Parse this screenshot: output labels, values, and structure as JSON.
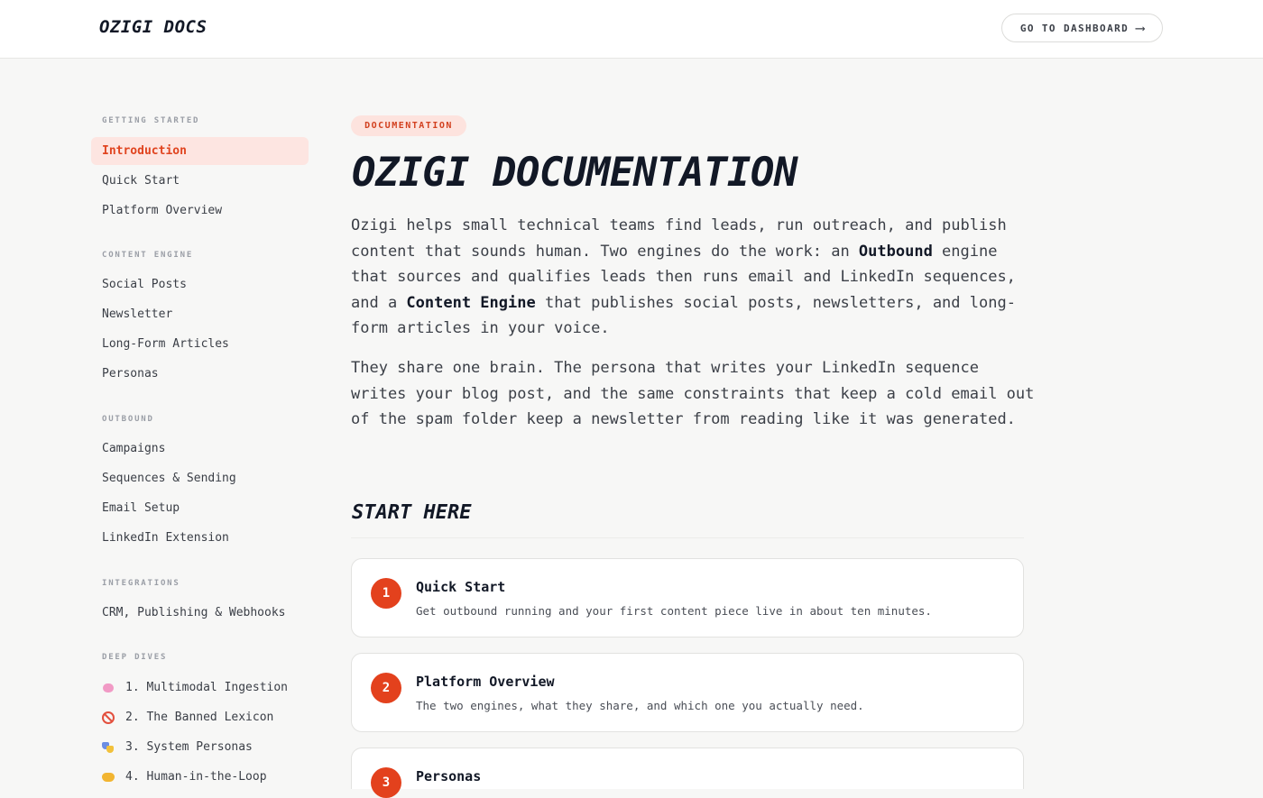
{
  "header": {
    "logo": "OZIGI DOCS",
    "dashboard_button": "GO TO DASHBOARD",
    "dashboard_arrow": "⟶"
  },
  "sidebar": {
    "sections": [
      {
        "title": "GETTING STARTED",
        "items": [
          "Introduction",
          "Quick Start",
          "Platform Overview"
        ]
      },
      {
        "title": "CONTENT ENGINE",
        "items": [
          "Social Posts",
          "Newsletter",
          "Long-Form Articles",
          "Personas"
        ]
      },
      {
        "title": "OUTBOUND",
        "items": [
          "Campaigns",
          "Sequences & Sending",
          "Email Setup",
          "LinkedIn Extension"
        ]
      },
      {
        "title": "INTEGRATIONS",
        "items": [
          "CRM, Publishing & Webhooks"
        ]
      },
      {
        "title": "DEEP DIVES",
        "items": [
          "1. Multimodal Ingestion",
          "2. The Banned Lexicon",
          "3. System Personas",
          "4. Human-in-the-Loop"
        ]
      }
    ],
    "active_item": "Introduction",
    "deep_dive_icons": [
      "brain-icon",
      "no-entry-icon",
      "performing-arts-icon",
      "handshake-icon"
    ]
  },
  "main": {
    "badge": "DOCUMENTATION",
    "title": "OZIGI DOCUMENTATION",
    "intro": {
      "p1_a": "Ozigi helps small technical teams find leads, run outreach, and publish content that sounds human. Two engines do the work: an ",
      "p1_b": "Outbound",
      "p1_c": " engine that sources and qualifies leads then runs email and LinkedIn sequences, and a ",
      "p1_d": "Content Engine",
      "p1_e": " that publishes social posts, newsletters, and long-form articles in your voice.",
      "p2": "They share one brain. The persona that writes your LinkedIn sequence writes your blog post, and the same constraints that keep a cold email out of the spam folder keep a newsletter from reading like it was generated."
    },
    "start_here_title": "START HERE",
    "cards": [
      {
        "number": "1",
        "title": "Quick Start",
        "description": "Get outbound running and your first content piece live in about ten minutes."
      },
      {
        "number": "2",
        "title": "Platform Overview",
        "description": "The two engines, what they share, and which one you actually need."
      },
      {
        "number": "3",
        "title": "Personas",
        "description": ""
      }
    ]
  },
  "colors": {
    "accent": "#e3411d",
    "active_bg": "#fde5e1",
    "text_dark": "#121826"
  }
}
